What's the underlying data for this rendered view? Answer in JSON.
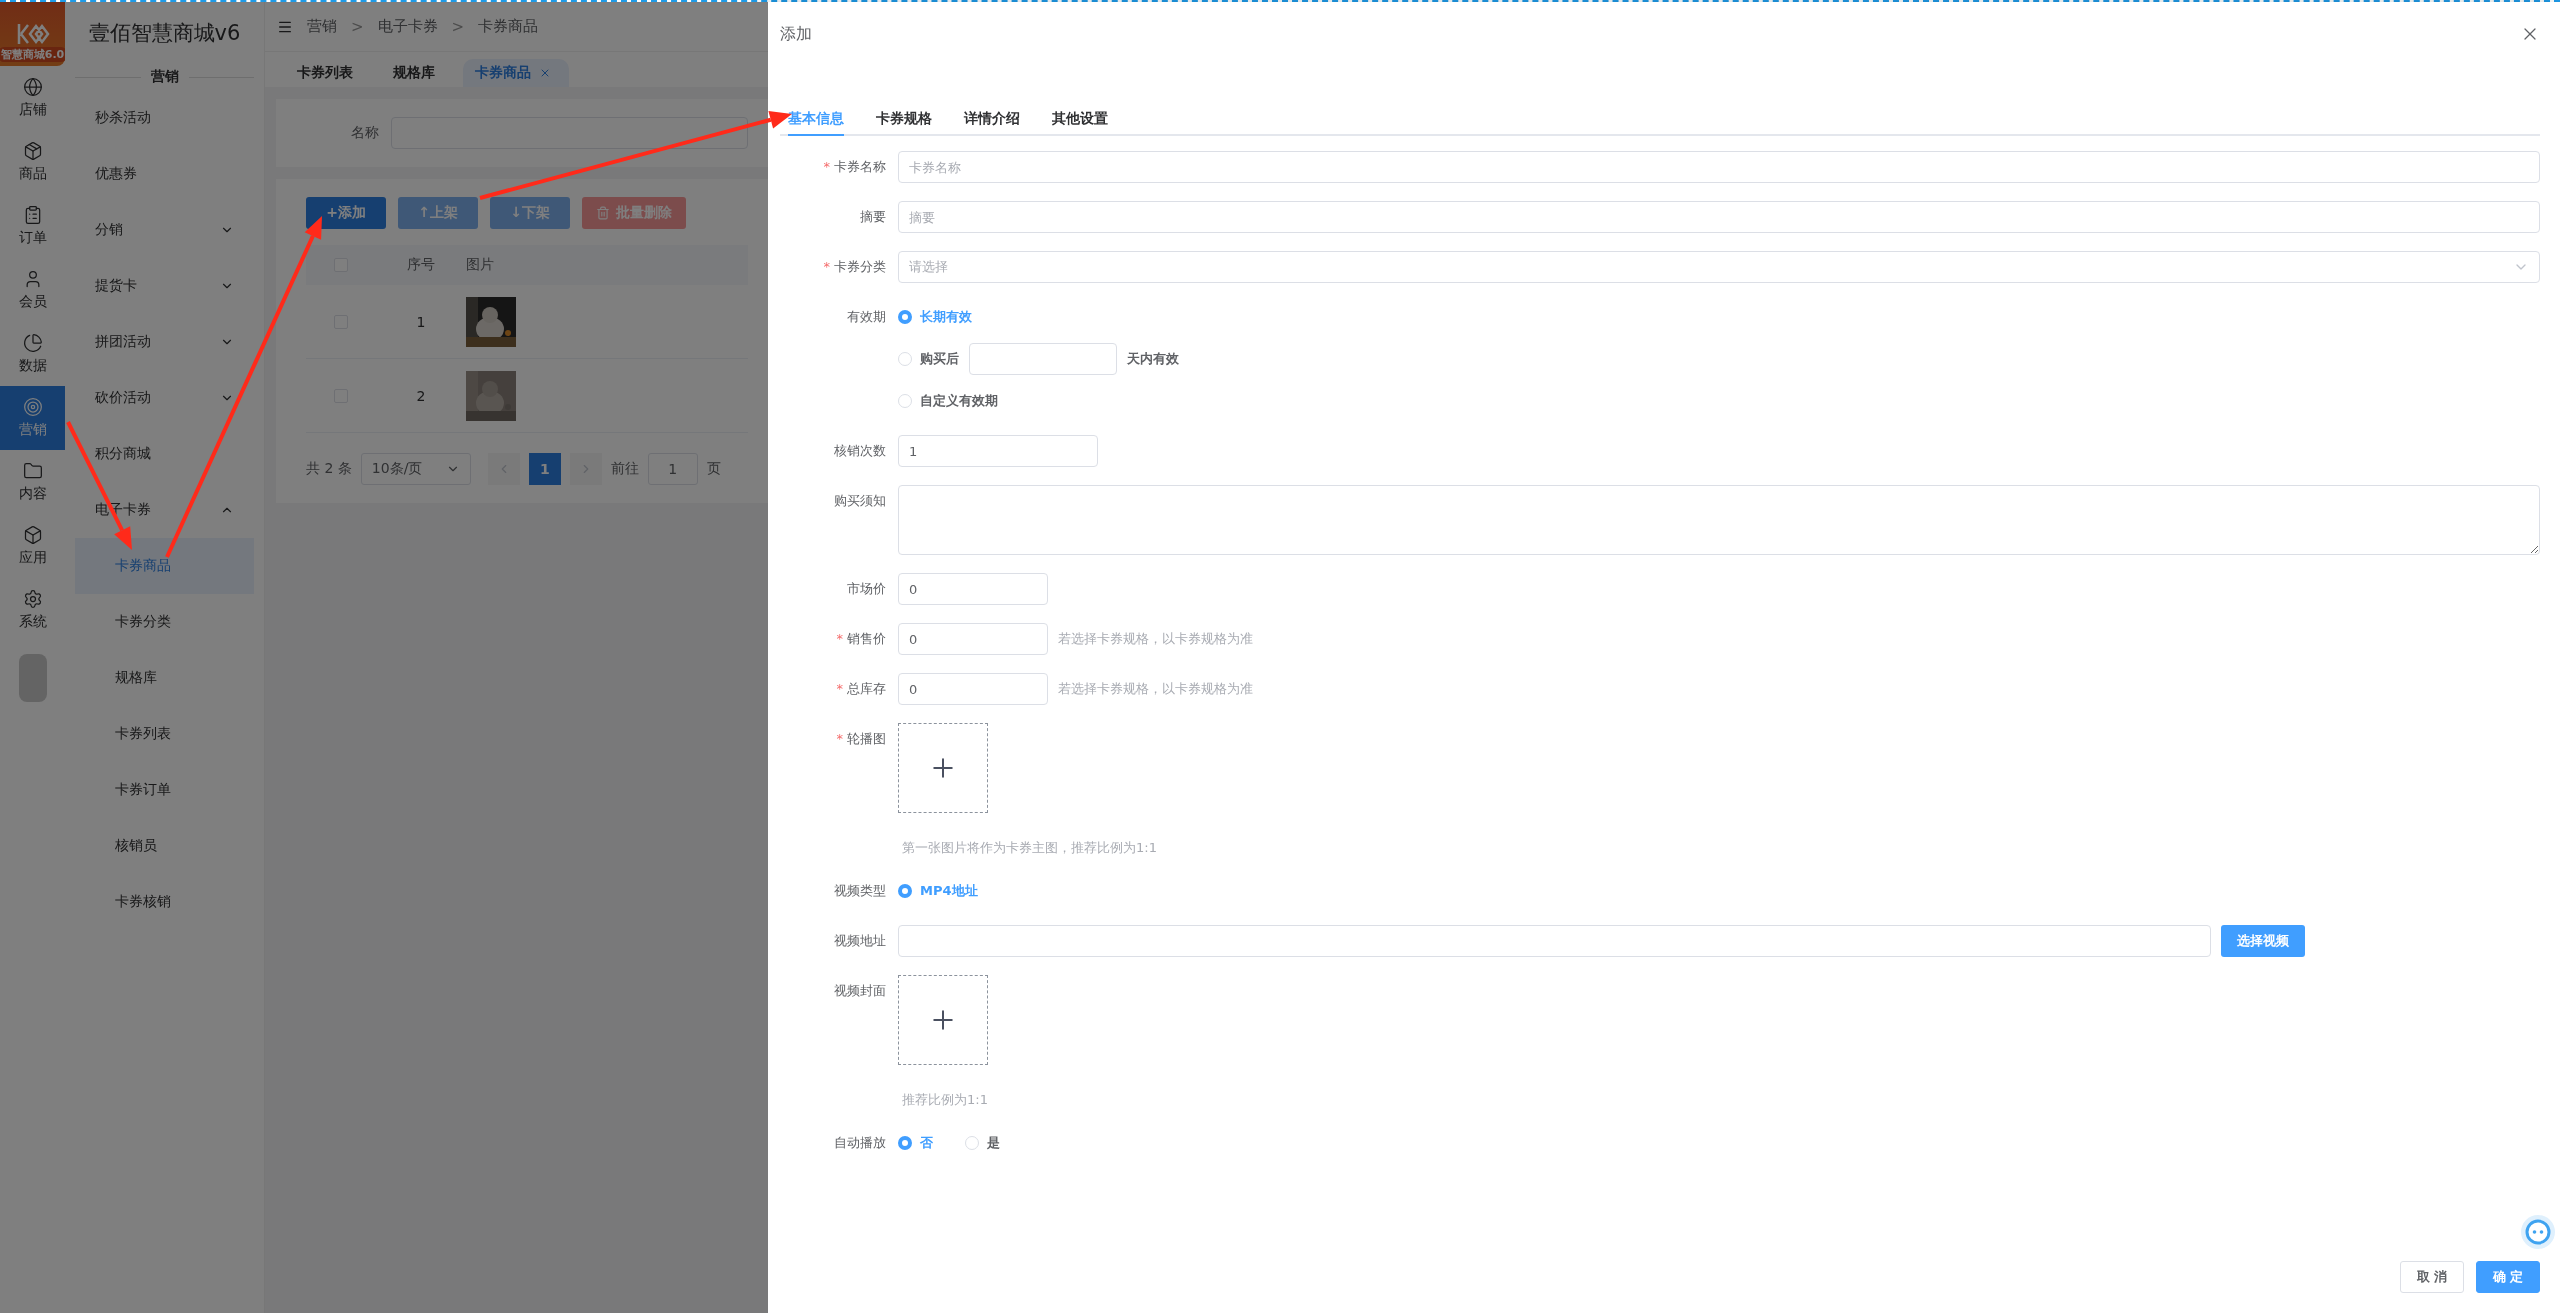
{
  "app": {
    "logo_text": "智慧商城6.0",
    "title": "壹佰智慧商城v6",
    "section": "营销"
  },
  "rail": [
    {
      "label": "店铺",
      "selected": false
    },
    {
      "label": "商品",
      "selected": false
    },
    {
      "label": "订单",
      "selected": false
    },
    {
      "label": "会员",
      "selected": false
    },
    {
      "label": "数据",
      "selected": false
    },
    {
      "label": "营销",
      "selected": true
    },
    {
      "label": "内容",
      "selected": false
    },
    {
      "label": "应用",
      "selected": false
    },
    {
      "label": "系统",
      "selected": false
    }
  ],
  "sidebar": [
    {
      "kind": "item",
      "label": "秒杀活动",
      "selected": false
    },
    {
      "kind": "item",
      "label": "优惠券",
      "selected": false
    },
    {
      "kind": "group",
      "label": "分销",
      "expanded": false
    },
    {
      "kind": "group",
      "label": "提货卡",
      "expanded": false
    },
    {
      "kind": "group",
      "label": "拼团活动",
      "expanded": false
    },
    {
      "kind": "group",
      "label": "砍价活动",
      "expanded": false
    },
    {
      "kind": "item",
      "label": "积分商城",
      "selected": false
    },
    {
      "kind": "group",
      "label": "电子卡券",
      "expanded": true,
      "children": [
        {
          "label": "卡券商品",
          "selected": true
        },
        {
          "label": "卡券分类",
          "selected": false
        },
        {
          "label": "规格库",
          "selected": false
        },
        {
          "label": "卡券列表",
          "selected": false
        },
        {
          "label": "卡券订单",
          "selected": false
        },
        {
          "label": "核销员",
          "selected": false
        },
        {
          "label": "卡券核销",
          "selected": false
        }
      ]
    }
  ],
  "breadcrumb": [
    "营销",
    "电子卡券",
    "卡券商品"
  ],
  "breadcrumb_separator": ">",
  "page_tabs": [
    {
      "label": "卡券列表",
      "selected": false
    },
    {
      "label": "规格库",
      "selected": false
    },
    {
      "label": "卡券商品",
      "selected": true
    }
  ],
  "search": {
    "label": "名称"
  },
  "actions": [
    {
      "label": "+添加",
      "kind": "primary",
      "disabled": false
    },
    {
      "label": "↑上架",
      "kind": "primary",
      "disabled": true
    },
    {
      "label": "↓下架",
      "kind": "primary",
      "disabled": true
    },
    {
      "label": "批量删除",
      "kind": "danger",
      "disabled": true
    }
  ],
  "table": {
    "header_checked": false,
    "columns": [
      "序号",
      "图片"
    ],
    "rows": [
      {
        "index": "1",
        "checked": false
      },
      {
        "index": "2",
        "checked": false
      }
    ]
  },
  "pagination": {
    "total": "共 2 条",
    "page_size": "10条/页",
    "pages": [
      {
        "label": "1",
        "selected": true
      }
    ],
    "goto_label": "前往",
    "goto_value": "1",
    "page_suffix": "页"
  },
  "drawer": {
    "title": "添加",
    "required_mark": "*",
    "tabs": [
      {
        "label": "基本信息",
        "selected": true
      },
      {
        "label": "卡券规格",
        "selected": false
      },
      {
        "label": "详情介绍",
        "selected": false
      },
      {
        "label": "其他设置",
        "selected": false
      }
    ],
    "form": [
      {
        "kind": "input",
        "label": "卡券名称",
        "required": true,
        "placeholder": "卡券名称"
      },
      {
        "kind": "input",
        "label": "摘要",
        "required": false,
        "placeholder": "摘要"
      },
      {
        "kind": "select",
        "label": "卡券分类",
        "required": true,
        "placeholder": "请选择"
      },
      {
        "kind": "radio",
        "label": "有效期",
        "required": false,
        "stacked": true,
        "options": [
          {
            "label": "长期有效",
            "selected": true
          },
          {
            "label": "购买后",
            "suffix": "天内有效",
            "selected": false
          },
          {
            "label": "自定义有效期",
            "selected": false
          }
        ]
      },
      {
        "kind": "count_input",
        "label": "核销次数",
        "required": false,
        "value": "1"
      },
      {
        "kind": "textarea",
        "label": "购买须知",
        "required": false
      },
      {
        "kind": "short_input",
        "label": "市场价",
        "required": false,
        "value": "0"
      },
      {
        "kind": "short_input",
        "label": "销售价",
        "required": true,
        "value": "0",
        "hint": "若选择卡券规格，以卡券规格为准"
      },
      {
        "kind": "short_input",
        "label": "总库存",
        "required": true,
        "value": "0",
        "hint": "若选择卡券规格，以卡券规格为准"
      },
      {
        "kind": "upload",
        "label": "轮播图",
        "required": true,
        "hint": "第一张图片将作为卡券主图，推荐比例为1:1"
      },
      {
        "kind": "radio",
        "label": "视频类型",
        "required": false,
        "stacked": false,
        "options": [
          {
            "label": "MP4地址",
            "selected": true
          }
        ]
      },
      {
        "kind": "input_button",
        "label": "视频地址",
        "required": false,
        "button": "选择视频"
      },
      {
        "kind": "upload",
        "label": "视频封面",
        "required": false,
        "hint": "推荐比例为1:1"
      },
      {
        "kind": "radio",
        "label": "自动播放",
        "required": false,
        "stacked": false,
        "options": [
          {
            "label": "否",
            "selected": true
          },
          {
            "label": "是",
            "selected": false
          }
        ]
      }
    ],
    "footer": [
      {
        "label": "取 消",
        "kind": "default"
      },
      {
        "label": "确 定",
        "kind": "primary"
      }
    ]
  }
}
